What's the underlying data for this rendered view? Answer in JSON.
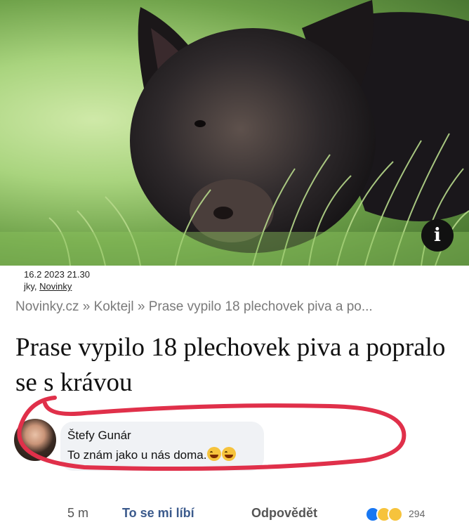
{
  "article": {
    "image_icon": "pig-photo",
    "info_icon": "i",
    "meta_date": "16.2 2023 21.30",
    "meta_author_prefix": "jky,",
    "meta_author_link": "Novinky",
    "breadcrumb": "Novinky.cz » Koktejl » Prase vypilo 18 plechovek piva a po...",
    "headline": "Prase vypilo 18 plechovek piva a popralo se s krávou"
  },
  "comment": {
    "author": "Štefy Gunár",
    "text": "To znám jako u nás doma.",
    "emojis": [
      "laughing-tears-emoji",
      "laughing-tears-emoji"
    ],
    "time": "5 m",
    "like_label": "To se mi líbí",
    "reply_label": "Odpovědět",
    "reactions": [
      "like-reaction-icon",
      "haha-reaction-icon",
      "wow-reaction-icon"
    ],
    "reaction_count": "294",
    "highlight_color": "#e0304a"
  }
}
